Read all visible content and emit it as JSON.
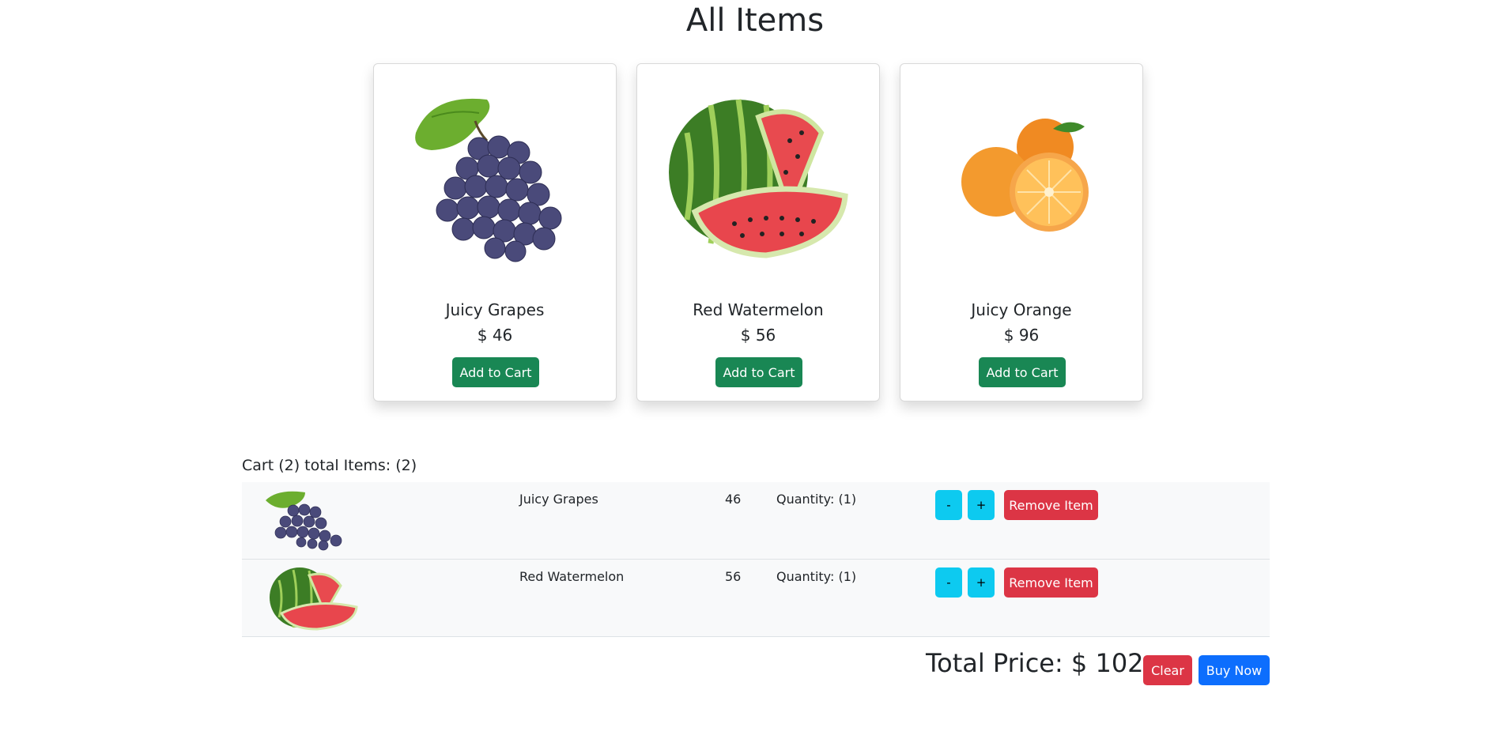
{
  "page": {
    "title": "All Items"
  },
  "products": [
    {
      "name": "Juicy Grapes",
      "price": "$ 46",
      "button": "Add to Cart",
      "image": "grapes-image"
    },
    {
      "name": "Red Watermelon",
      "price": "$ 56",
      "button": "Add to Cart",
      "image": "watermelon-image"
    },
    {
      "name": "Juicy Orange",
      "price": "$ 96",
      "button": "Add to Cart",
      "image": "orange-image"
    }
  ],
  "cart": {
    "heading": "Cart (2) total Items: (2)",
    "items": [
      {
        "name": "Juicy Grapes",
        "price": "46",
        "quantity": "Quantity: (1)",
        "minus": "-",
        "plus": "+",
        "remove": "Remove Item",
        "image": "grapes-image"
      },
      {
        "name": "Red Watermelon",
        "price": "56",
        "quantity": "Quantity: (1)",
        "minus": "-",
        "plus": "+",
        "remove": "Remove Item",
        "image": "watermelon-image"
      }
    ],
    "total": "Total Price: $ 102",
    "clear": "Clear",
    "buy": "Buy Now"
  },
  "colors": {
    "success": "#198754",
    "danger": "#dc3545",
    "info": "#0dcaf0",
    "primary": "#0d6efd"
  }
}
